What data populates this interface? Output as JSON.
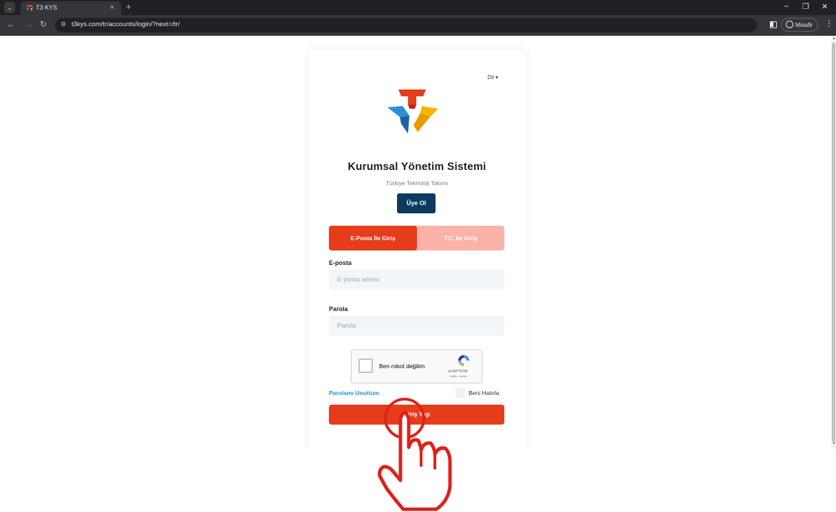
{
  "browser": {
    "tab_title": "T3 KYS",
    "url": "t3kys.com/tr/accounts/login/?next=/tr/",
    "profile_label": "Misafir"
  },
  "page": {
    "language_label": "Dil",
    "title": "Kurumsal Yönetim Sistemi",
    "subtitle": "Türkiye Teknoloji Takımı",
    "signup_label": "Üye Ol",
    "tabs": [
      {
        "label": "E-Posta İle Giriş",
        "active": true
      },
      {
        "label": "T.C. İle Giriş",
        "active": false
      }
    ],
    "email": {
      "label": "E-posta",
      "placeholder": "E-posta adresi"
    },
    "password": {
      "label": "Parola",
      "placeholder": "Parola"
    },
    "captcha": {
      "label": "Ben robot değilim",
      "brand": "reCAPTCHA",
      "terms": "Gizlilik - Şartlar"
    },
    "forgot_label": "Parolamı Unuttum",
    "remember_label": "Beni Hatırla",
    "submit_label": "Giriş Yap"
  },
  "colors": {
    "accent_red": "#e53d1b",
    "accent_red_light": "#fbb3a9",
    "signup_navy": "#0d3a5f",
    "link_blue": "#2a8fd6",
    "hand_overlay": "#e0201b"
  },
  "icons": [
    "chevron-down-icon",
    "close-icon",
    "plus-icon",
    "back-icon",
    "forward-icon",
    "reload-icon",
    "site-info-icon",
    "side-panel-icon",
    "profile-icon",
    "more-menu-icon",
    "t3-logo",
    "recaptcha-icon",
    "pointing-hand-icon"
  ]
}
